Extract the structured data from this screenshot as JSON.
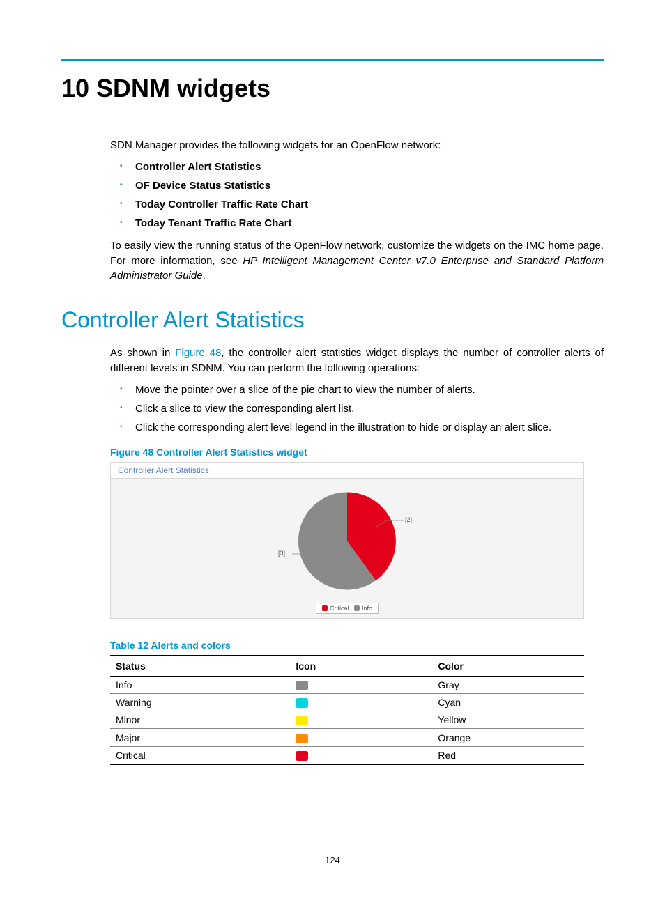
{
  "chapter_title": "10 SDNM widgets",
  "intro_para": "SDN Manager provides the following widgets for an OpenFlow network:",
  "widget_list": [
    "Controller Alert Statistics",
    "OF Device Status Statistics",
    "Today Controller Traffic Rate Chart",
    "Today Tenant Traffic Rate Chart"
  ],
  "intro_para2_a": "To easily view the running status of the OpenFlow network, customize the widgets on the IMC home page. For more information, see ",
  "intro_para2_em": "HP Intelligent Management Center v7.0 Enterprise and Standard Platform Administrator Guide",
  "intro_para2_b": ".",
  "section_title": "Controller Alert Statistics",
  "section_para1_a": "As shown in ",
  "section_para1_link": "Figure 48",
  "section_para1_b": ", the controller alert statistics widget displays the number of controller alerts of different levels in SDNM. You can perform the following operations:",
  "ops_list": [
    "Move the pointer over a slice of the pie chart to view the number of alerts.",
    "Click a slice to view the corresponding alert list.",
    "Click the corresponding alert level legend in the illustration to hide or display an alert slice."
  ],
  "figure_caption": "Figure 48 Controller Alert Statistics widget",
  "widget_header": "Controller Alert Statistics",
  "chart_data": {
    "type": "pie",
    "title": "Controller Alert Statistics",
    "series": [
      {
        "name": "Critical",
        "value": 2,
        "color": "#e2001a",
        "label": "[2]"
      },
      {
        "name": "Info",
        "value": 3,
        "color": "#8a8a8a",
        "label": "[3]"
      }
    ],
    "legend": [
      "Critical",
      "Info"
    ]
  },
  "table_caption": "Table 12 Alerts and colors",
  "table": {
    "headers": [
      "Status",
      "Icon",
      "Color"
    ],
    "rows": [
      {
        "status": "Info",
        "color_name": "Gray",
        "swatch": "#8a8a8a"
      },
      {
        "status": "Warning",
        "color_name": "Cyan",
        "swatch": "#00d5dd"
      },
      {
        "status": "Minor",
        "color_name": "Yellow",
        "swatch": "#ffeb00"
      },
      {
        "status": "Major",
        "color_name": "Orange",
        "swatch": "#ff8c00"
      },
      {
        "status": "Critical",
        "color_name": "Red",
        "swatch": "#e2001a"
      }
    ]
  },
  "page_number": "124"
}
